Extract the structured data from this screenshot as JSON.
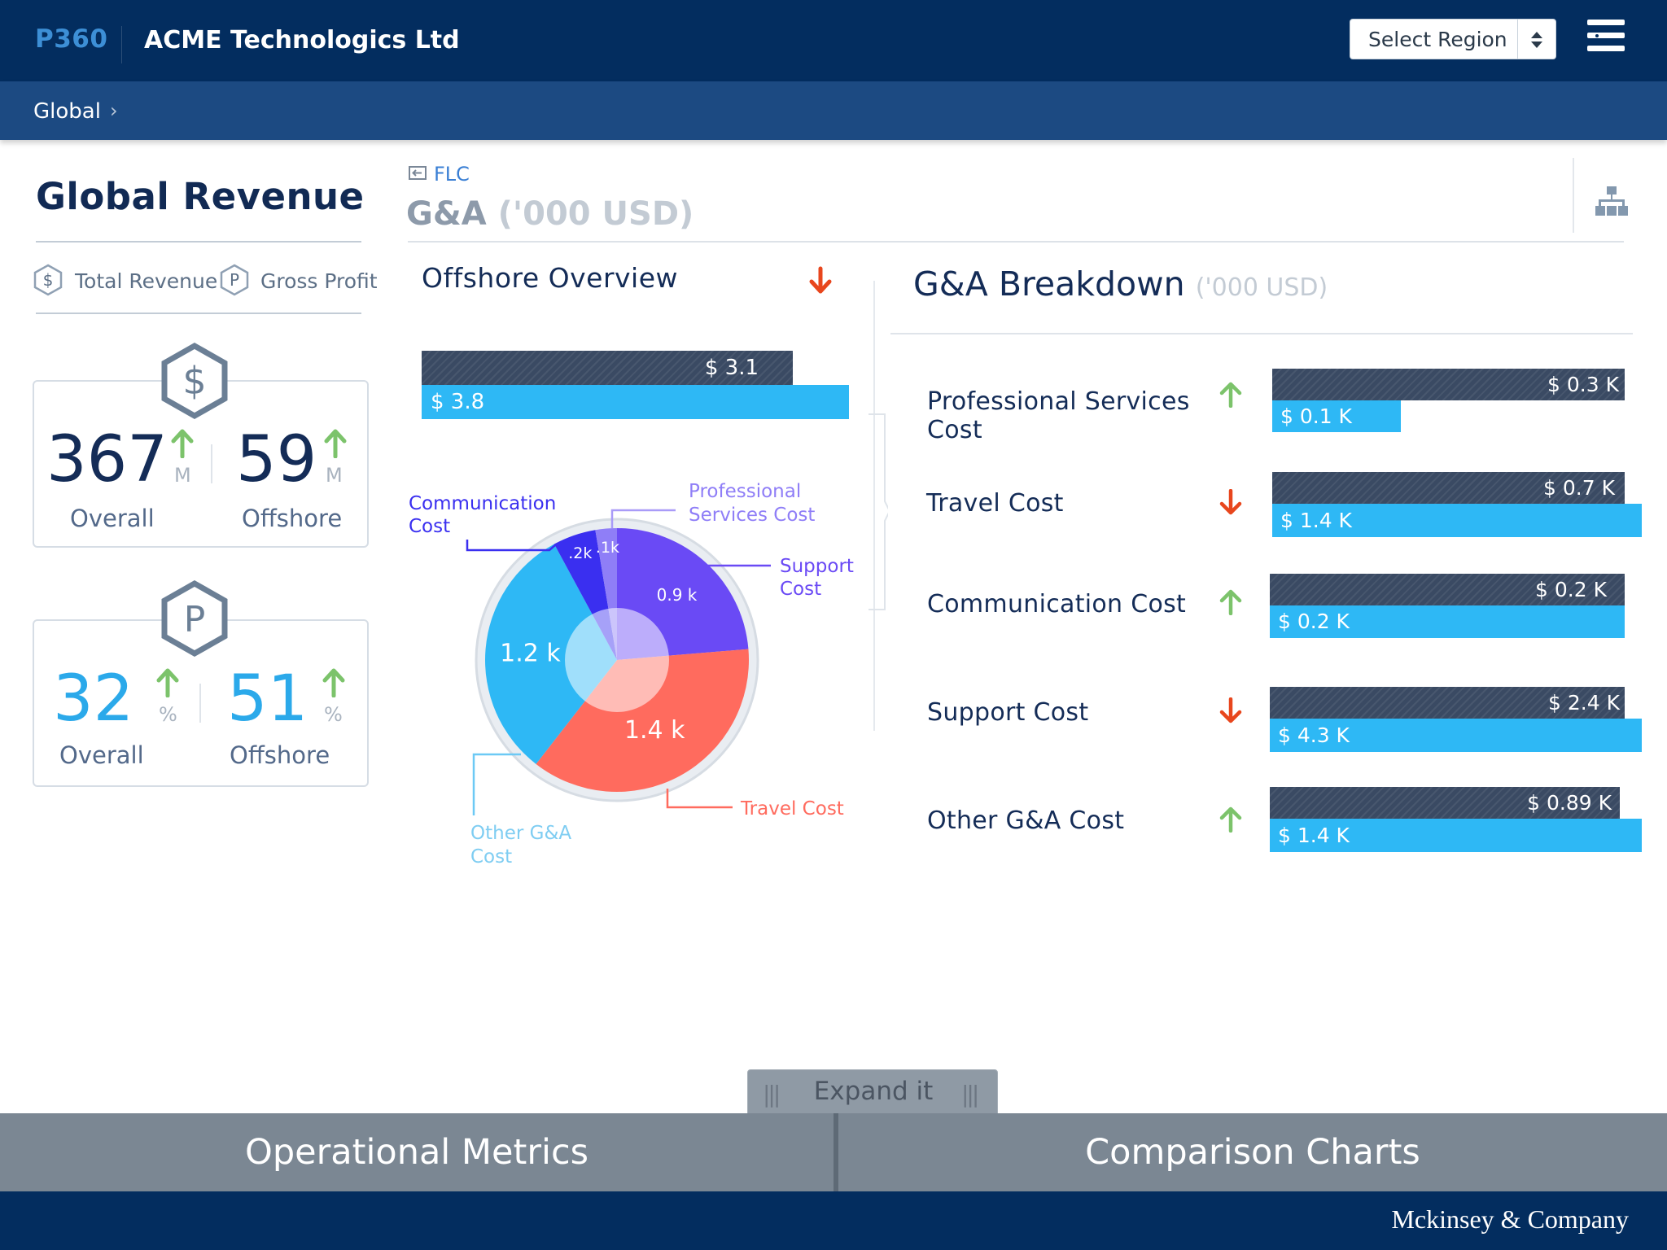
{
  "header": {
    "brand": "P360",
    "company": "ACME Technologics Ltd",
    "region_select": "Select Region"
  },
  "breadcrumb": {
    "item": "Global"
  },
  "left_panel": {
    "title": "Global Revenue",
    "legend": [
      {
        "icon": "S",
        "label": "Total Revenue"
      },
      {
        "icon": "P",
        "label": "Gross Profit"
      }
    ],
    "revenue_card": {
      "icon": "$",
      "overall_value": "367",
      "overall_unit": "M",
      "overall_label": "Overall",
      "offshore_value": "59",
      "offshore_unit": "M",
      "offshore_label": "Offshore"
    },
    "profit_card": {
      "icon": "P",
      "overall_value": "32",
      "overall_unit": "%",
      "overall_label": "Overall",
      "offshore_value": "51",
      "offshore_unit": "%",
      "offshore_label": "Offshore"
    }
  },
  "center": {
    "flc_link": "FLC",
    "title": "G&A",
    "title_sub": "('000 USD)",
    "offshore_overview": {
      "title": "Offshore Overview",
      "trend": "down",
      "dark_value": 3.1,
      "dark_label": "$ 3.1",
      "light_value": 3.8,
      "light_label": "$ 3.8"
    }
  },
  "chart_data": {
    "type": "pie",
    "slices": [
      {
        "name": "Support Cost",
        "value": 0.9,
        "label": "0.9 k",
        "color": "#6a4af5"
      },
      {
        "name": "Travel Cost",
        "value": 1.4,
        "label": "1.4 k",
        "color": "#ff6b5e"
      },
      {
        "name": "Other G&A Cost",
        "value": 1.2,
        "label": "1.2 k",
        "color": "#2eb8f5"
      },
      {
        "name": "Communication Cost",
        "value": 0.2,
        "label": ".2k",
        "color": "#3a2ff0"
      },
      {
        "name": "Professional Services Cost",
        "value": 0.1,
        "label": ".1k",
        "color": "#8f7ef7"
      }
    ],
    "callouts": {
      "communication": [
        "Communication",
        "Cost"
      ],
      "professional": [
        "Professional",
        "Services Cost"
      ],
      "support": [
        "Support",
        "Cost"
      ],
      "travel": [
        "Travel Cost"
      ],
      "other": [
        "Other G&A",
        "Cost"
      ]
    }
  },
  "breakdown": {
    "title": "G&A Breakdown",
    "subtitle": "('000 USD)",
    "rows": [
      {
        "label": "Professional Services Cost",
        "trend": "up",
        "dark_label": "$ 0.3 K",
        "light_label": "$ 0.1 K"
      },
      {
        "label": "Travel Cost",
        "trend": "down",
        "dark_label": "$ 0.7 K",
        "light_label": "$ 1.4 K"
      },
      {
        "label": "Communication Cost",
        "trend": "up",
        "dark_label": "$ 0.2 K",
        "light_label": "$ 0.2 K"
      },
      {
        "label": "Support Cost",
        "trend": "down",
        "dark_label": "$ 2.4 K",
        "light_label": "$ 4.3 K"
      },
      {
        "label": "Other G&A Cost",
        "trend": "up",
        "dark_label": "$ 0.89 K",
        "light_label": "$ 1.4 K"
      }
    ]
  },
  "bottom": {
    "expand_label": "Expand it",
    "grip": "|||",
    "tab_left": "Operational Metrics",
    "tab_right": "Comparison Charts"
  },
  "footer": {
    "company": "Mckinsey & Company"
  },
  "colors": {
    "navy": "#032d5f",
    "accent_blue": "#2eb8f5",
    "bar_dark": "#3a4a63",
    "up_arrow": "#7cc36b",
    "down_arrow": "#e8461d"
  }
}
